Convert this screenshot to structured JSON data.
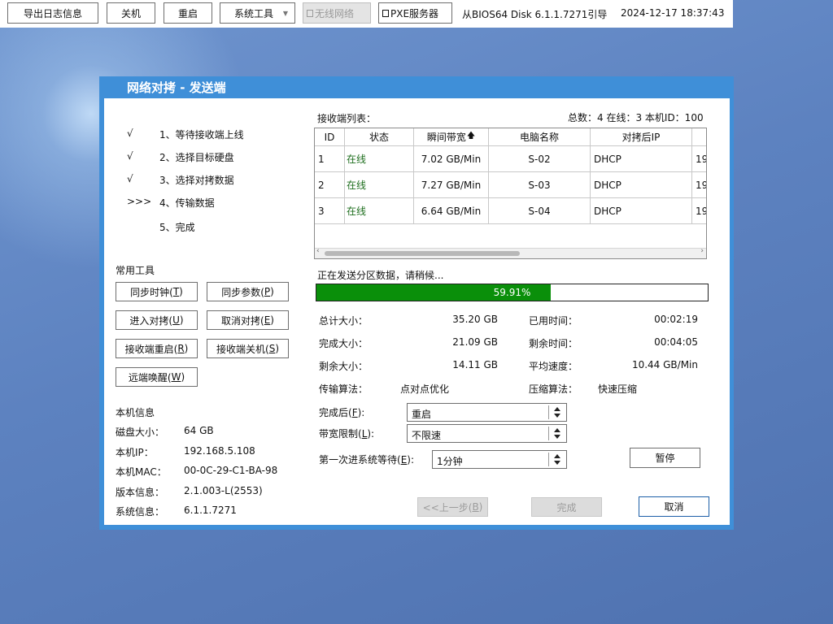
{
  "topbar": {
    "export_log": "导出日志信息",
    "shutdown": "关机",
    "restart": "重启",
    "system_tools": "系统工具",
    "wireless": "无线网络",
    "pxe_server": "PXE服务器",
    "boot_info": "从BIOS64 Disk 6.1.1.7271引导",
    "datetime": "2024-12-17 18:37:43"
  },
  "dialog": {
    "title": "网络对拷 - 发送端",
    "steps": [
      {
        "mark": "√",
        "label": "1、等待接收端上线"
      },
      {
        "mark": "√",
        "label": "2、选择目标硬盘"
      },
      {
        "mark": "√",
        "label": "3、选择对拷数据"
      },
      {
        "mark": ">>>",
        "label": "4、传输数据"
      },
      {
        "mark": "",
        "label": "5、完成"
      }
    ],
    "tools": {
      "heading": "常用工具",
      "sync_clock": {
        "text": "同步时钟(",
        "key": "T",
        "end": ")"
      },
      "sync_params": {
        "text": "同步参数(",
        "key": "P",
        "end": ")"
      },
      "enter_copy": {
        "text": "进入对拷(",
        "key": "U",
        "end": ")"
      },
      "cancel_copy": {
        "text": "取消对拷(",
        "key": "E",
        "end": ")"
      },
      "receiver_restart": {
        "text": "接收端重启(",
        "key": "R",
        "end": ")"
      },
      "receiver_shutdown": {
        "text": "接收端关机(",
        "key": "S",
        "end": ")"
      },
      "remote_wake": {
        "text": "远端唤醒(",
        "key": "W",
        "end": ")"
      }
    },
    "local_info": {
      "heading": "本机信息",
      "rows": [
        {
          "label": "磁盘大小：",
          "value": "64 GB"
        },
        {
          "label": "本机IP：",
          "value": "192.168.5.108"
        },
        {
          "label": "本机MAC：",
          "value": "00-0C-29-C1-BA-98"
        },
        {
          "label": "版本信息：",
          "value": "2.1.003-L(2553)"
        },
        {
          "label": "系统信息：",
          "value": "6.1.1.7271"
        }
      ]
    },
    "receivers": {
      "heading": "接收端列表：",
      "summary": "总数：4  在线：3  本机ID：100",
      "columns": [
        "ID",
        "状态",
        "瞬间带宽",
        "电脑名称",
        "对拷后IP",
        ""
      ],
      "sort_icon": "arrow-up-icon",
      "rows": [
        [
          "1",
          "在线",
          "7.02 GB/Min",
          "S-02",
          "DHCP",
          "19"
        ],
        [
          "2",
          "在线",
          "7.27 GB/Min",
          "S-03",
          "DHCP",
          "19"
        ],
        [
          "3",
          "在线",
          "6.64 GB/Min",
          "S-04",
          "DHCP",
          "19"
        ]
      ]
    },
    "progress": {
      "status": "正在发送分区数据，请稍候...",
      "percent": 59.91,
      "text": "59.91%",
      "color": "#0a8f0a"
    },
    "stats": {
      "total_label": "总计大小：",
      "total": "35.20 GB",
      "elapsed_label": "已用时间：",
      "elapsed": "00:02:19",
      "done_label": "完成大小：",
      "done": "21.09 GB",
      "remaining_time_label": "剩余时间：",
      "remaining_time": "00:04:05",
      "left_label": "剩余大小：",
      "left": "14.11 GB",
      "speed_label": "平均速度：",
      "speed": "10.44 GB/Min",
      "algo_label": "传输算法：",
      "algo": "点对点优化",
      "compress_label": "压缩算法：",
      "compress": "快速压缩"
    },
    "options": {
      "after_label": {
        "text": "完成后(",
        "key": "F",
        "end": "):"
      },
      "after_value": "重启",
      "bandwidth_label": {
        "text": "带宽限制(",
        "key": "L",
        "end": "):"
      },
      "bandwidth_value": "不限速",
      "wait_label": {
        "text": "第一次进系统等待(",
        "key": "E",
        "end": "):"
      },
      "wait_value": "1分钟"
    },
    "buttons": {
      "pause": "暂停",
      "prev": {
        "text": "<<上一步(",
        "key": "B",
        "end": ")"
      },
      "finish": "完成",
      "cancel": "取消"
    }
  }
}
